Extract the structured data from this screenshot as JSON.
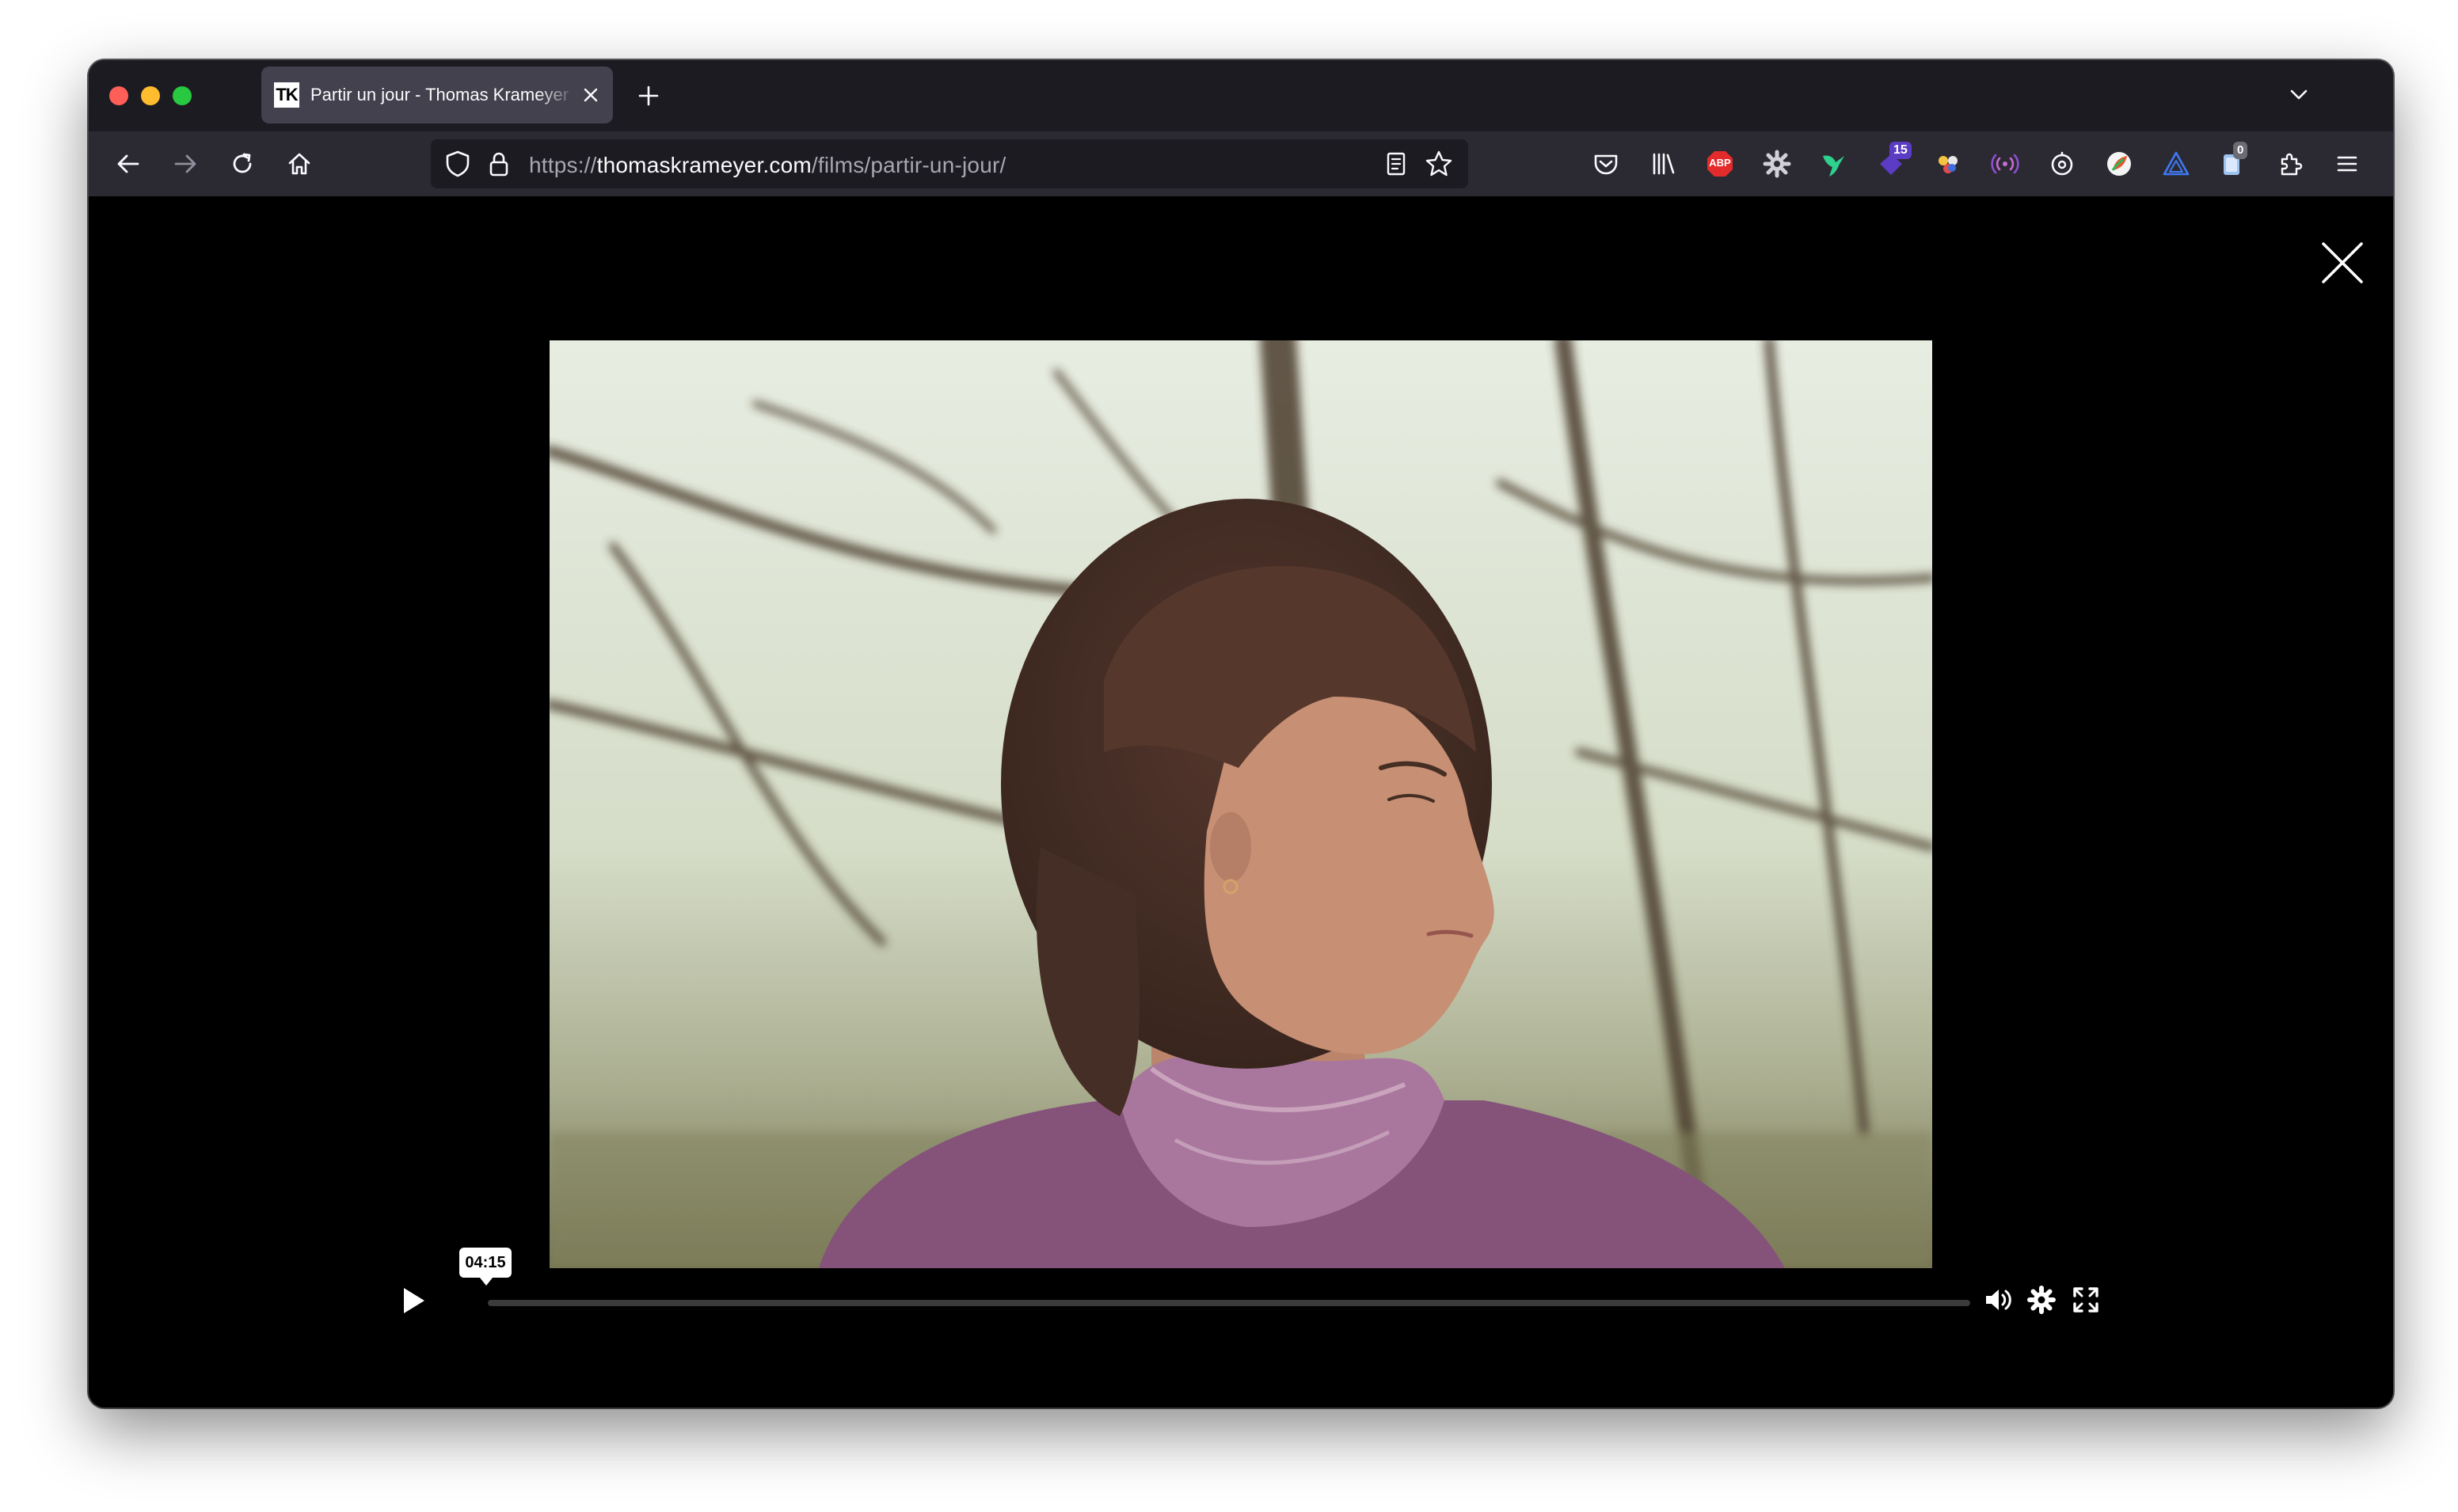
{
  "browser": {
    "tab": {
      "favicon_text": "TK",
      "title": "Partir un jour - Thomas Krameyer"
    },
    "url": {
      "scheme": "https://",
      "domain": "thomaskrameyer.com",
      "path": "/films/partir-un-jour/"
    },
    "extensions": {
      "abp_label": "ABP",
      "badge_15": "15",
      "badge_0": "0"
    },
    "colors": {
      "tab_strip": "#1c1b22",
      "toolbar": "#2b2a33",
      "active_tab": "#42414d",
      "url_field": "#1c1b22"
    }
  },
  "player": {
    "tooltip_time": "04:15",
    "progress_fraction": 0.0,
    "icons": [
      "play-icon",
      "volume-icon",
      "settings-icon",
      "fullscreen-icon",
      "close-icon"
    ]
  }
}
